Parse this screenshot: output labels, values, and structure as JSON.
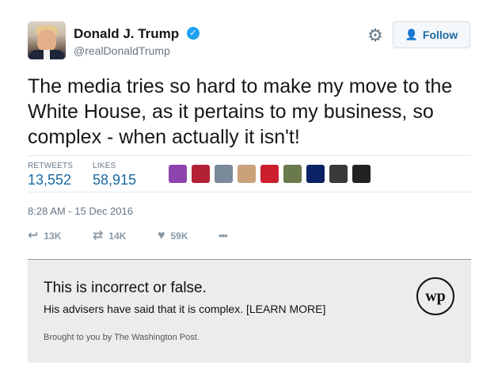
{
  "user": {
    "name": "Donald J. Trump",
    "handle": "@realDonaldTrump",
    "verified_icon": "check"
  },
  "header": {
    "settings_icon": "gear-icon",
    "follow_label": "Follow"
  },
  "tweet": {
    "text": "The media tries so hard to make my move to the White House, as it pertains to my business, so complex - when actually it isn't!",
    "timestamp": "8:28 AM - 15 Dec 2016"
  },
  "stats": {
    "retweets_label": "RETWEETS",
    "retweets_value": "13,552",
    "likes_label": "LIKES",
    "likes_value": "58,915"
  },
  "likers": [
    {
      "color": "#8e44ad"
    },
    {
      "color": "#b22234"
    },
    {
      "color": "#7a8a9a"
    },
    {
      "color": "#c9a27a"
    },
    {
      "color": "#cc1f2d"
    },
    {
      "color": "#6b7a4a"
    },
    {
      "color": "#0b2265"
    },
    {
      "color": "#3a3a3a"
    },
    {
      "color": "#222222"
    }
  ],
  "actions": {
    "reply_count": "13K",
    "retweet_count": "14K",
    "like_count": "59K",
    "more_icon": "•••"
  },
  "fact_check": {
    "title": "This is incorrect or false.",
    "detail": "His advisers have said that it is complex. [LEARN MORE]",
    "credit": "Brought to you by The Washington Post.",
    "logo_text": "wp"
  }
}
